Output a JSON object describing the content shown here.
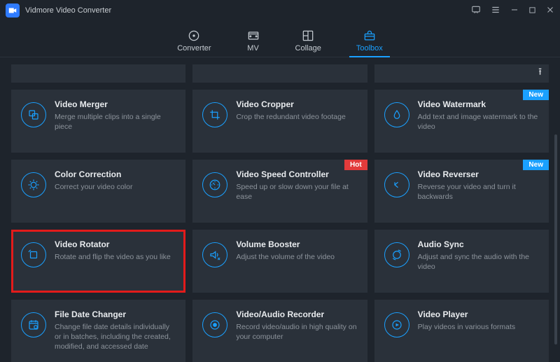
{
  "app": {
    "title": "Vidmore Video Converter"
  },
  "tabs": [
    {
      "id": "converter",
      "label": "Converter",
      "active": false
    },
    {
      "id": "mv",
      "label": "MV",
      "active": false
    },
    {
      "id": "collage",
      "label": "Collage",
      "active": false
    },
    {
      "id": "toolbox",
      "label": "Toolbox",
      "active": true
    }
  ],
  "tools": [
    {
      "row": "partial"
    },
    {
      "row": "partial"
    },
    {
      "row": "partial",
      "upload": true
    },
    {
      "name": "Video Merger",
      "desc": "Merge multiple clips into a single piece",
      "icon": "merger"
    },
    {
      "name": "Video Cropper",
      "desc": "Crop the redundant video footage",
      "icon": "cropper"
    },
    {
      "name": "Video Watermark",
      "desc": "Add text and image watermark to the video",
      "icon": "watermark",
      "badge": "New"
    },
    {
      "name": "Color Correction",
      "desc": "Correct your video color",
      "icon": "color"
    },
    {
      "name": "Video Speed Controller",
      "desc": "Speed up or slow down your file at ease",
      "icon": "speed",
      "badge": "Hot"
    },
    {
      "name": "Video Reverser",
      "desc": "Reverse your video and turn it backwards",
      "icon": "reverse",
      "badge": "New"
    },
    {
      "name": "Video Rotator",
      "desc": "Rotate and flip the video as you like",
      "icon": "rotate",
      "highlight": true
    },
    {
      "name": "Volume Booster",
      "desc": "Adjust the volume of the video",
      "icon": "volume"
    },
    {
      "name": "Audio Sync",
      "desc": "Adjust and sync the audio with the video",
      "icon": "sync"
    },
    {
      "name": "File Date Changer",
      "desc": "Change file date details individually or in batches, including the created, modified, and accessed date",
      "icon": "date"
    },
    {
      "name": "Video/Audio Recorder",
      "desc": "Record video/audio in high quality on your computer",
      "icon": "recorder"
    },
    {
      "name": "Video Player",
      "desc": "Play videos in various formats",
      "icon": "player"
    }
  ],
  "colors": {
    "accent": "#1aa0ff",
    "hot": "#e23b3b",
    "new": "#1aa0ff",
    "highlight": "#e21b1b"
  }
}
